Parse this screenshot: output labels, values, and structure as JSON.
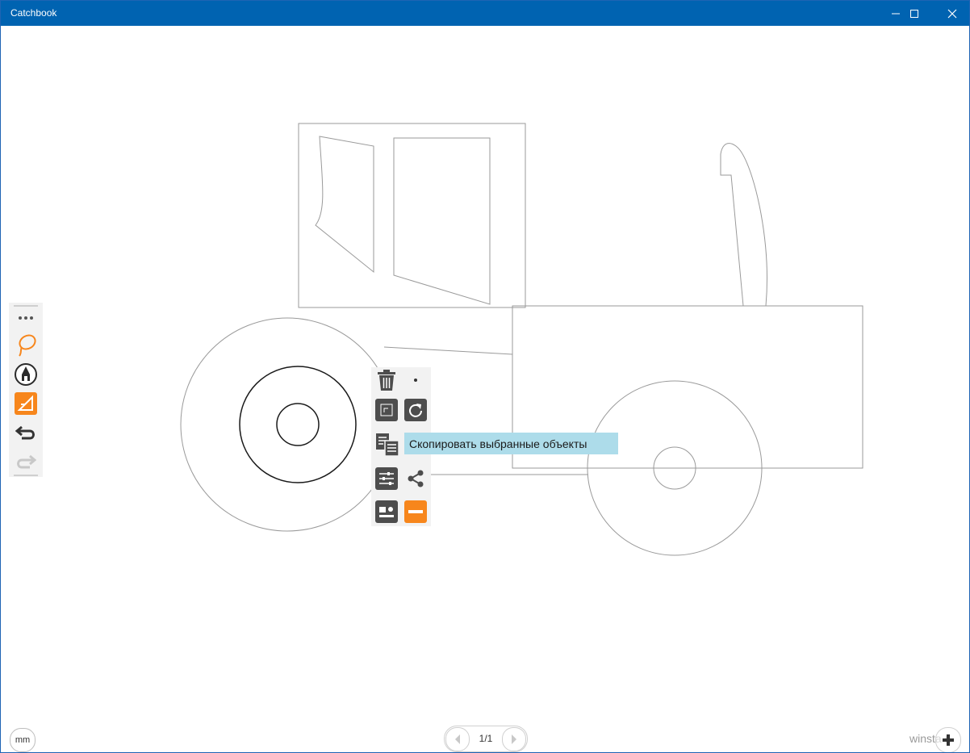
{
  "window": {
    "title": "Catchbook"
  },
  "titlebar_buttons": {
    "minimize_icon": "minimize-icon",
    "maximize_icon": "maximize-icon",
    "close_icon": "close-icon"
  },
  "left_toolbar": {
    "tools": [
      {
        "name": "more-options",
        "icon": "ellipsis-icon"
      },
      {
        "name": "lasso",
        "icon": "lasso-icon",
        "color": "#f7861c"
      },
      {
        "name": "pen",
        "icon": "pen-icon"
      },
      {
        "name": "ruler",
        "icon": "ruler-icon",
        "color": "#f7861c"
      },
      {
        "name": "undo",
        "icon": "undo-icon"
      },
      {
        "name": "redo",
        "icon": "redo-icon",
        "disabled": true
      }
    ]
  },
  "context_menu": {
    "items": [
      {
        "name": "delete",
        "icon": "trash-icon"
      },
      {
        "name": "dot",
        "icon": "dot-icon"
      },
      {
        "name": "transform",
        "icon": "transform-icon"
      },
      {
        "name": "rotate",
        "icon": "rotate-icon"
      },
      {
        "name": "copy",
        "icon": "copy-icon"
      },
      {
        "name": "properties",
        "icon": "sliders-icon"
      },
      {
        "name": "share",
        "icon": "share-icon"
      },
      {
        "name": "card",
        "icon": "card-icon"
      },
      {
        "name": "line-style",
        "icon": "line-icon",
        "color": "#f7861c"
      }
    ],
    "tooltip": "Скопировать выбранные объекты"
  },
  "bottom": {
    "units": "mm",
    "page_label": "1/1",
    "watermark": "winsta u"
  },
  "colors": {
    "titlebar": "#0063b1",
    "accent": "#f7861c",
    "icon_dark": "#4d4d4d",
    "tooltip_bg": "#addcea"
  }
}
